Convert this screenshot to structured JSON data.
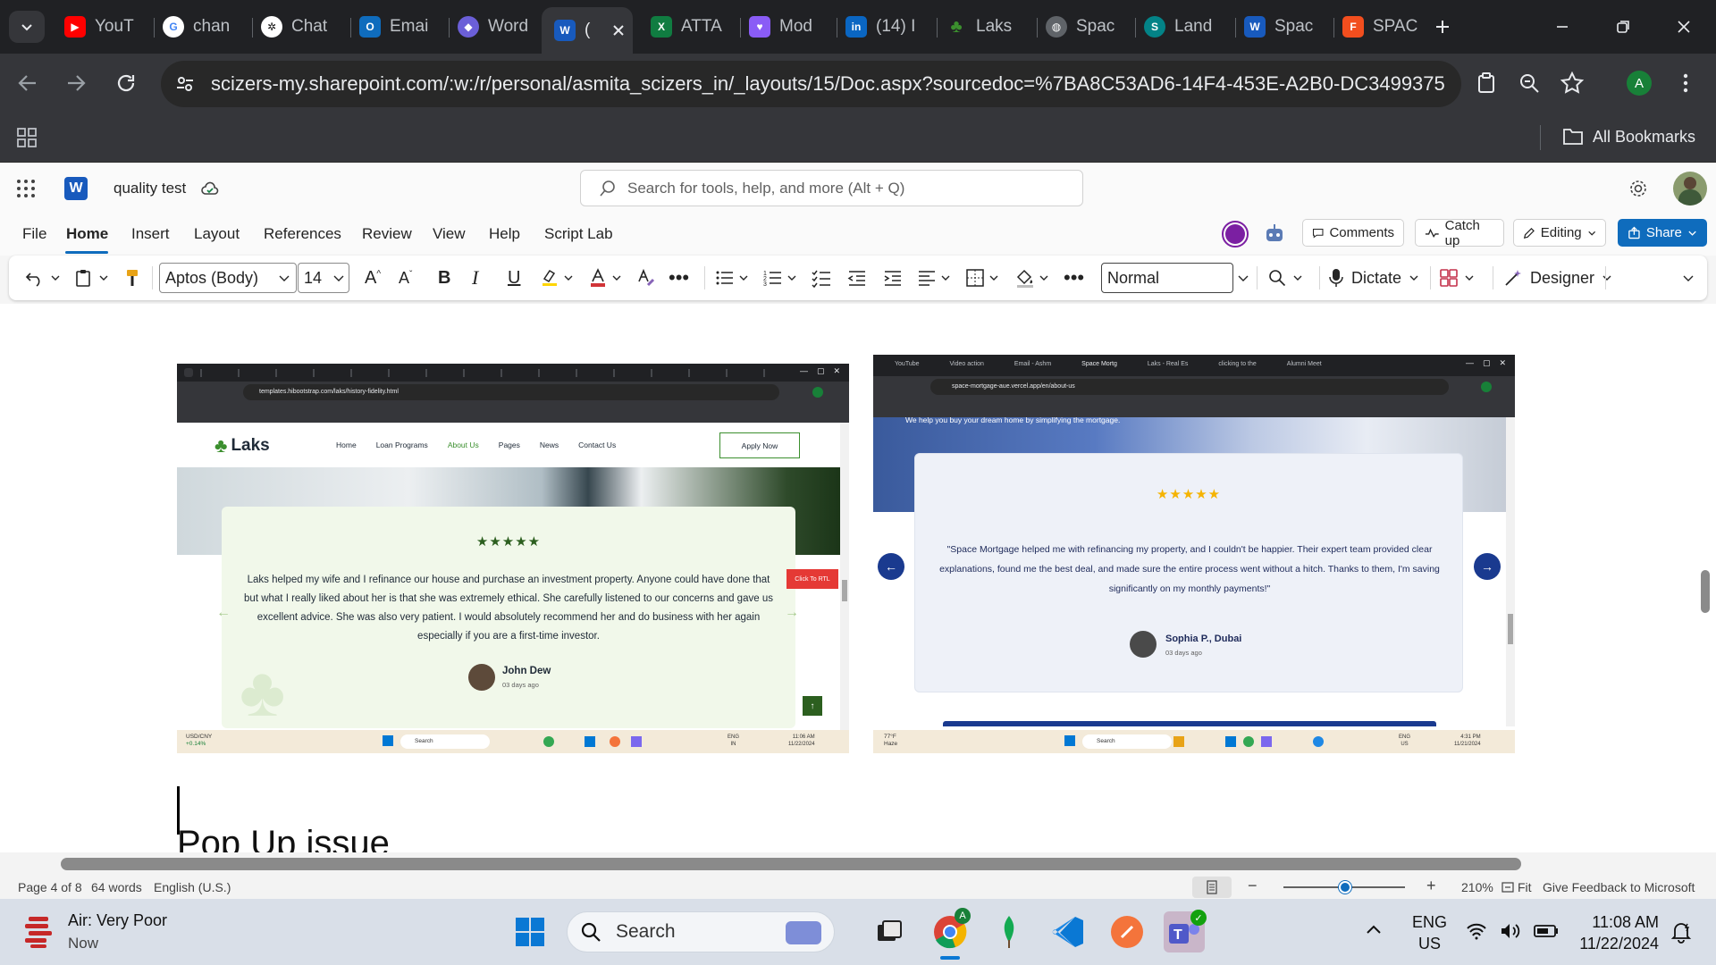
{
  "browser": {
    "tabs": [
      {
        "label": "YouT",
        "icon": "youtube-icon",
        "color": "#ff0000"
      },
      {
        "label": "chan",
        "icon": "google-icon",
        "color": "#ffffff"
      },
      {
        "label": "Chat",
        "icon": "chatgpt-icon",
        "color": "#ffffff"
      },
      {
        "label": "Emai",
        "icon": "outlook-icon",
        "color": "#0f6cbd"
      },
      {
        "label": "Word",
        "icon": "copilot-icon",
        "color": "#6b5fd8"
      },
      {
        "label": "(",
        "icon": "word-icon",
        "color": "#185abd"
      },
      {
        "label": "ATTA",
        "icon": "excel-icon",
        "color": "#107c41"
      },
      {
        "label": "Mod",
        "icon": "heart-icon",
        "color": "#8a5cf6"
      },
      {
        "label": "(14) I",
        "icon": "linkedin-icon",
        "color": "#0a66c2"
      },
      {
        "label": "Laks",
        "icon": "clover-icon",
        "color": "#3b8f2e"
      },
      {
        "label": "Spac",
        "icon": "globe-icon",
        "color": "#9aa0a6"
      },
      {
        "label": "Land",
        "icon": "sharepoint-icon",
        "color": "#038387"
      },
      {
        "label": "Spac",
        "icon": "word-icon",
        "color": "#185abd"
      },
      {
        "label": "SPAC",
        "icon": "figma-icon",
        "color": "#f24e1e"
      }
    ],
    "url": "scizers-my.sharepoint.com/:w:/r/personal/asmita_scizers_in/_layouts/15/Doc.aspx?sourcedoc=%7BA8C53AD6-14F4-453E-A2B0-DC3499375D4A%7D...",
    "profile_initial": "A",
    "bookmarks_label": "All Bookmarks"
  },
  "word": {
    "doc_title": "quality test",
    "search_placeholder": "Search for tools, help, and more (Alt + Q)",
    "menu": [
      "File",
      "Home",
      "Insert",
      "Layout",
      "References",
      "Review",
      "View",
      "Help",
      "Script Lab"
    ],
    "comments_label": "Comments",
    "catchup_label": "Catch up",
    "editing_label": "Editing",
    "share_label": "Share",
    "font_name": "Aptos (Body)",
    "font_size": "14",
    "style_name": "Normal",
    "dictate_label": "Dictate",
    "designer_label": "Designer",
    "heading_text": "Pop Up issue",
    "status": {
      "page": "Page 4 of 8",
      "words": "64 words",
      "language": "English (U.S.)",
      "zoom": "210%",
      "fit": "Fit",
      "feedback": "Give Feedback to Microsoft"
    }
  },
  "shot_left": {
    "url": "templates.hibootstrap.com/laks/history-fidelity.html",
    "brand": "Laks",
    "nav": [
      "Home",
      "Loan Programs",
      "About Us",
      "Pages",
      "News",
      "Contact Us"
    ],
    "apply_label": "Apply Now",
    "stars": "★★★★★",
    "quote": "Laks helped my wife and I refinance our house and purchase an investment property. Anyone could have done that but what I really liked about her is that she was extremely ethical. She carefully listened to our concerns and gave us excellent advice. She was also very patient. I would absolutely recommend her and do business with her again especially if you are a first-time investor.",
    "author": "John Dew",
    "date": "03 days ago",
    "rtl_label": "Click To RTL",
    "ticker": "USD/CNY",
    "ticker_change": "+0.14%",
    "search": "Search",
    "time": "11:06 AM",
    "date_tb": "11/22/2024",
    "lang": "ENG",
    "region": "IN"
  },
  "shot_right": {
    "url": "space-mortgage-aue.vercel.app/en/about-us",
    "tabs": [
      "YouTube",
      "Video action",
      "Email - Ashm",
      "Space Mortg",
      "Laks - Real Es",
      "clicking to the",
      "Alumni Meet"
    ],
    "hero_text": "We help you buy your dream home by simplifying the mortgage.",
    "stars": "★★★★★",
    "quote": "\"Space Mortgage helped me with refinancing my property, and I couldn't be happier. Their expert team provided clear explanations, found me the best deal, and made sure the entire process went without a hitch. Thanks to them, I'm saving significantly on my monthly payments!\"",
    "author": "Sophia P., Dubai",
    "date": "03 days ago",
    "weather": "77°F",
    "weather_desc": "Haze",
    "search": "Search",
    "time": "4:31 PM",
    "date_tb": "11/21/2024",
    "lang": "ENG",
    "region": "US"
  },
  "taskbar": {
    "weather_title": "Air: Very Poor",
    "weather_sub": "Now",
    "search_label": "Search",
    "lang": "ENG",
    "region": "US",
    "time": "11:08 AM",
    "date": "11/22/2024"
  }
}
